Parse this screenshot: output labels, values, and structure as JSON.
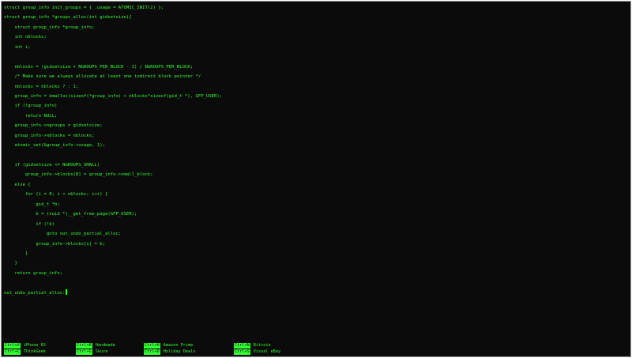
{
  "colors": {
    "foreground": "#33ff33",
    "background": "#0b0b0b",
    "border": "#9a9a9a"
  },
  "editor": {
    "lines": [
      "struct group_info init_groups = { .usage = ATOMIC_INIT(2) };",
      "struct group_info *groups_alloc(int gidsetsize){",
      "    struct group_info *group_info;",
      "    int nblocks;",
      "    int i;",
      "",
      "    nblocks = (gidsetsize + NGROUPS_PER_BLOCK - 1) / NGROUPS_PER_BLOCK;",
      "    /* Make sure we always allocate at least one indirect block pointer */",
      "    nblocks = nblocks ? : 1;",
      "    group_info = kmalloc(sizeof(*group_info) + nblocks*sizeof(gid_t *), GFP_USER);",
      "    if (!group_info)",
      "        return NULL;",
      "    group_info->ngroups = gidsetsize;",
      "    group_info->nblocks = nblocks;",
      "    atomic_set(&group_info->usage, 1);",
      "",
      "    if (gidsetsize <= NGROUPS_SMALL)",
      "        group_info->blocks[0] = group_info->small_block;",
      "    else {",
      "        for (i = 0; i < nblocks; i++) {",
      "            gid_t *b;",
      "            b = (void *)__get_free_page(GFP_USER);",
      "            if (!b)",
      "                goto out_undo_partial_alloc;",
      "            group_info->blocks[i] = b;",
      "        }",
      "    }",
      "    return group_info;",
      "",
      "out_undo_partial_alloc:"
    ]
  },
  "menu": {
    "columns": [
      [
        {
          "key": "Ctrl+X",
          "label": "iPhone 6S"
        },
        {
          "key": "Ctrl+C",
          "label": "ThinkGeek"
        }
      ],
      [
        {
          "key": "Ctrl+B",
          "label": "Handmade"
        },
        {
          "key": "Ctrl+G",
          "label": "Skure"
        }
      ],
      [
        {
          "key": "Ctrl+H",
          "label": "Amazon Prime"
        },
        {
          "key": "Ctrl+D",
          "label": "Holiday Deals"
        }
      ],
      [
        {
          "key": "Ctrl+N",
          "label": "Bitcoin"
        },
        {
          "key": "Ctrl+S",
          "label": "Visual eBay"
        }
      ]
    ]
  }
}
